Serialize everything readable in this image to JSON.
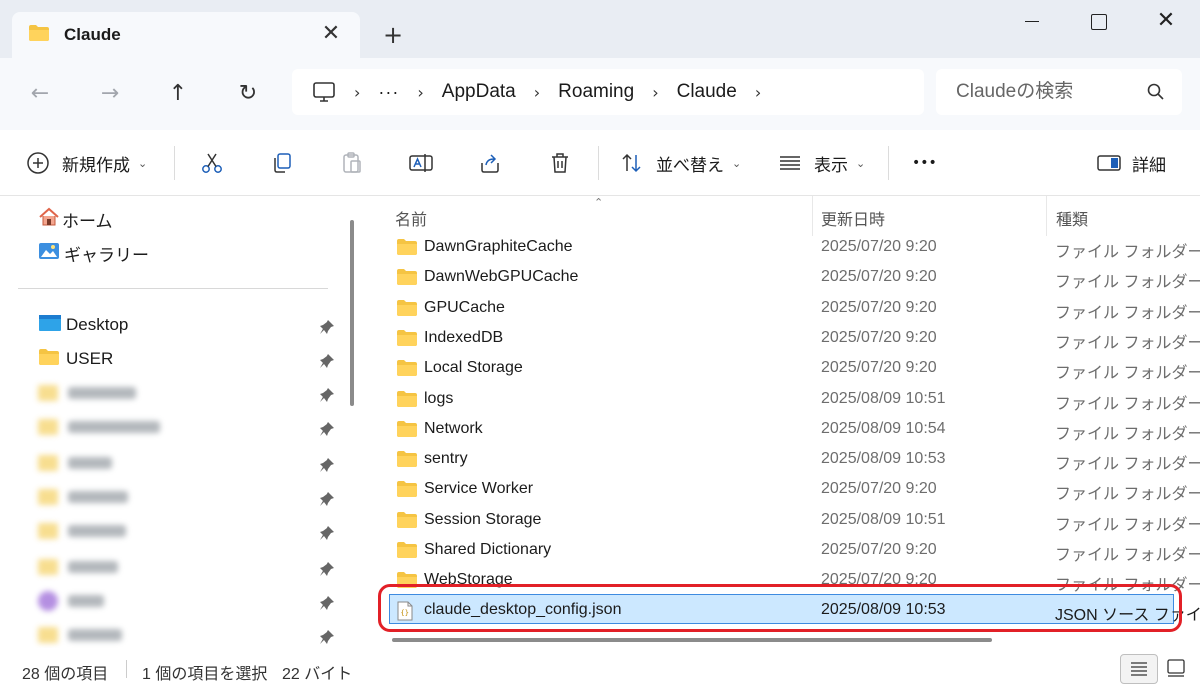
{
  "tab": {
    "title": "Claude",
    "close_glyph": "✕"
  },
  "new_tab_glyph": "+",
  "window_controls": {
    "close_glyph": "✕"
  },
  "nav": {
    "back_glyph": "←",
    "forward_glyph": "→",
    "up_glyph": "↑",
    "refresh_glyph": "↻"
  },
  "address": {
    "overflow": "···",
    "crumbs": [
      "AppData",
      "Roaming",
      "Claude"
    ],
    "separator": "›"
  },
  "search": {
    "placeholder": "Claudeの検索"
  },
  "commandbar": {
    "new_label": "新規作成",
    "sort_label": "並べ替え",
    "view_label": "表示",
    "more_label": "•••",
    "details_label": "詳細",
    "chevron": "⌄"
  },
  "sidebar": {
    "home_label": "ホーム",
    "gallery_label": "ギャラリー",
    "desktop_label": "Desktop",
    "user_label": "USER"
  },
  "columns": {
    "name": "名前",
    "modified": "更新日時",
    "type": "種類",
    "sort_glyph": "⌃"
  },
  "files": [
    {
      "name": "DawnGraphiteCache",
      "modified": "2025/07/20 9:20",
      "type": "ファイル フォルダー"
    },
    {
      "name": "DawnWebGPUCache",
      "modified": "2025/07/20 9:20",
      "type": "ファイル フォルダー"
    },
    {
      "name": "GPUCache",
      "modified": "2025/07/20 9:20",
      "type": "ファイル フォルダー"
    },
    {
      "name": "IndexedDB",
      "modified": "2025/07/20 9:20",
      "type": "ファイル フォルダー"
    },
    {
      "name": "Local Storage",
      "modified": "2025/07/20 9:20",
      "type": "ファイル フォルダー"
    },
    {
      "name": "logs",
      "modified": "2025/08/09 10:51",
      "type": "ファイル フォルダー"
    },
    {
      "name": "Network",
      "modified": "2025/08/09 10:54",
      "type": "ファイル フォルダー"
    },
    {
      "name": "sentry",
      "modified": "2025/08/09 10:53",
      "type": "ファイル フォルダー"
    },
    {
      "name": "Service Worker",
      "modified": "2025/07/20 9:20",
      "type": "ファイル フォルダー"
    },
    {
      "name": "Session Storage",
      "modified": "2025/08/09 10:51",
      "type": "ファイル フォルダー"
    },
    {
      "name": "Shared Dictionary",
      "modified": "2025/07/20 9:20",
      "type": "ファイル フォルダー"
    },
    {
      "name": "WebStorage",
      "modified": "2025/07/20 9:20",
      "type": "ファイル フォルダー"
    },
    {
      "name": "claude_desktop_config.json",
      "modified": "2025/08/09 10:53",
      "type": "JSON ソース ファイル"
    }
  ],
  "status": {
    "item_count": "28 個の項目",
    "selected": "1 個の項目を選択",
    "size": "22 バイト"
  },
  "colors": {
    "accent": "#0067c0",
    "selection": "#cce8ff",
    "highlight_ring": "#e22027",
    "folder": "#f5c443"
  }
}
